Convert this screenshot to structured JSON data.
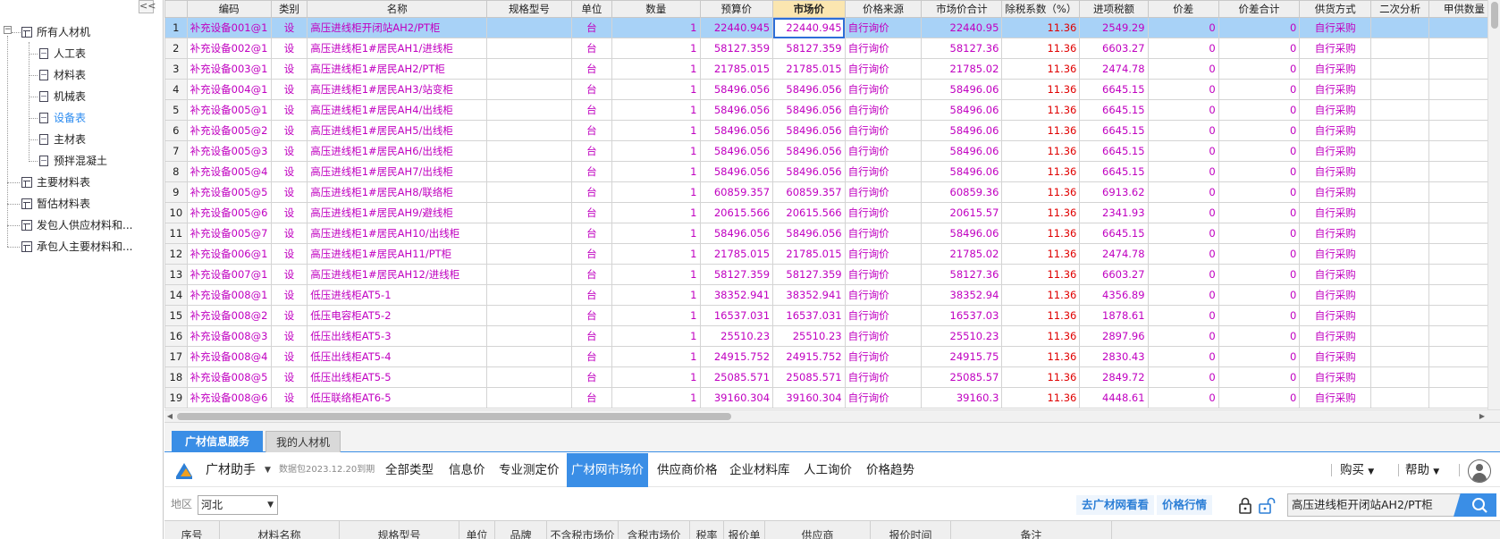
{
  "tree": {
    "collapse_label": "<<",
    "items": [
      {
        "label": "所有人材机",
        "icon": "table-icon"
      },
      {
        "label": "人工表",
        "icon": "doc-icon"
      },
      {
        "label": "材料表",
        "icon": "doc-icon"
      },
      {
        "label": "机械表",
        "icon": "doc-icon"
      },
      {
        "label": "设备表",
        "icon": "doc-icon",
        "selected": true
      },
      {
        "label": "主材表",
        "icon": "doc-icon"
      },
      {
        "label": "预拌混凝土",
        "icon": "doc-icon"
      },
      {
        "label": "主要材料表",
        "icon": "table-icon"
      },
      {
        "label": "暂估材料表",
        "icon": "table-icon"
      },
      {
        "label": "发包人供应材料和...",
        "icon": "table-icon"
      },
      {
        "label": "承包人主要材料和...",
        "icon": "table-icon"
      }
    ]
  },
  "grid": {
    "headers": [
      "编码",
      "类别",
      "名称",
      "规格型号",
      "单位",
      "数量",
      "预算价",
      "市场价",
      "价格来源",
      "市场价合计",
      "除税系数（%）",
      "进项税额",
      "价差",
      "价差合计",
      "供货方式",
      "二次分析",
      "甲供数量"
    ],
    "active_header": "市场价",
    "rows": [
      [
        "1",
        "补充设备001@1",
        "设",
        "高压进线柜开闭站AH2/PT柜",
        "",
        "台",
        "1",
        "22440.945",
        "22440.945",
        "自行询价",
        "22440.95",
        "11.36",
        "2549.29",
        "0",
        "0",
        "自行采购",
        "",
        ""
      ],
      [
        "2",
        "补充设备002@1",
        "设",
        "高压进线柜1#居民AH1/进线柜",
        "",
        "台",
        "1",
        "58127.359",
        "58127.359",
        "自行询价",
        "58127.36",
        "11.36",
        "6603.27",
        "0",
        "0",
        "自行采购",
        "",
        ""
      ],
      [
        "3",
        "补充设备003@1",
        "设",
        "高压进线柜1#居民AH2/PT柜",
        "",
        "台",
        "1",
        "21785.015",
        "21785.015",
        "自行询价",
        "21785.02",
        "11.36",
        "2474.78",
        "0",
        "0",
        "自行采购",
        "",
        ""
      ],
      [
        "4",
        "补充设备004@1",
        "设",
        "高压进线柜1#居民AH3/站变柜",
        "",
        "台",
        "1",
        "58496.056",
        "58496.056",
        "自行询价",
        "58496.06",
        "11.36",
        "6645.15",
        "0",
        "0",
        "自行采购",
        "",
        ""
      ],
      [
        "5",
        "补充设备005@1",
        "设",
        "高压进线柜1#居民AH4/出线柜",
        "",
        "台",
        "1",
        "58496.056",
        "58496.056",
        "自行询价",
        "58496.06",
        "11.36",
        "6645.15",
        "0",
        "0",
        "自行采购",
        "",
        ""
      ],
      [
        "6",
        "补充设备005@2",
        "设",
        "高压进线柜1#居民AH5/出线柜",
        "",
        "台",
        "1",
        "58496.056",
        "58496.056",
        "自行询价",
        "58496.06",
        "11.36",
        "6645.15",
        "0",
        "0",
        "自行采购",
        "",
        ""
      ],
      [
        "7",
        "补充设备005@3",
        "设",
        "高压进线柜1#居民AH6/出线柜",
        "",
        "台",
        "1",
        "58496.056",
        "58496.056",
        "自行询价",
        "58496.06",
        "11.36",
        "6645.15",
        "0",
        "0",
        "自行采购",
        "",
        ""
      ],
      [
        "8",
        "补充设备005@4",
        "设",
        "高压进线柜1#居民AH7/出线柜",
        "",
        "台",
        "1",
        "58496.056",
        "58496.056",
        "自行询价",
        "58496.06",
        "11.36",
        "6645.15",
        "0",
        "0",
        "自行采购",
        "",
        ""
      ],
      [
        "9",
        "补充设备005@5",
        "设",
        "高压进线柜1#居民AH8/联络柜",
        "",
        "台",
        "1",
        "60859.357",
        "60859.357",
        "自行询价",
        "60859.36",
        "11.36",
        "6913.62",
        "0",
        "0",
        "自行采购",
        "",
        ""
      ],
      [
        "10",
        "补充设备005@6",
        "设",
        "高压进线柜1#居民AH9/避线柜",
        "",
        "台",
        "1",
        "20615.566",
        "20615.566",
        "自行询价",
        "20615.57",
        "11.36",
        "2341.93",
        "0",
        "0",
        "自行采购",
        "",
        ""
      ],
      [
        "11",
        "补充设备005@7",
        "设",
        "高压进线柜1#居民AH10/出线柜",
        "",
        "台",
        "1",
        "58496.056",
        "58496.056",
        "自行询价",
        "58496.06",
        "11.36",
        "6645.15",
        "0",
        "0",
        "自行采购",
        "",
        ""
      ],
      [
        "12",
        "补充设备006@1",
        "设",
        "高压进线柜1#居民AH11/PT柜",
        "",
        "台",
        "1",
        "21785.015",
        "21785.015",
        "自行询价",
        "21785.02",
        "11.36",
        "2474.78",
        "0",
        "0",
        "自行采购",
        "",
        ""
      ],
      [
        "13",
        "补充设备007@1",
        "设",
        "高压进线柜1#居民AH12/进线柜",
        "",
        "台",
        "1",
        "58127.359",
        "58127.359",
        "自行询价",
        "58127.36",
        "11.36",
        "6603.27",
        "0",
        "0",
        "自行采购",
        "",
        ""
      ],
      [
        "14",
        "补充设备008@1",
        "设",
        "低压进线柜AT5-1",
        "",
        "台",
        "1",
        "38352.941",
        "38352.941",
        "自行询价",
        "38352.94",
        "11.36",
        "4356.89",
        "0",
        "0",
        "自行采购",
        "",
        ""
      ],
      [
        "15",
        "补充设备008@2",
        "设",
        "低压电容柜AT5-2",
        "",
        "台",
        "1",
        "16537.031",
        "16537.031",
        "自行询价",
        "16537.03",
        "11.36",
        "1878.61",
        "0",
        "0",
        "自行采购",
        "",
        ""
      ],
      [
        "16",
        "补充设备008@3",
        "设",
        "低压出线柜AT5-3",
        "",
        "台",
        "1",
        "25510.23",
        "25510.23",
        "自行询价",
        "25510.23",
        "11.36",
        "2897.96",
        "0",
        "0",
        "自行采购",
        "",
        ""
      ],
      [
        "17",
        "补充设备008@4",
        "设",
        "低压出线柜AT5-4",
        "",
        "台",
        "1",
        "24915.752",
        "24915.752",
        "自行询价",
        "24915.75",
        "11.36",
        "2830.43",
        "0",
        "0",
        "自行采购",
        "",
        ""
      ],
      [
        "18",
        "补充设备008@5",
        "设",
        "低压出线柜AT5-5",
        "",
        "台",
        "1",
        "25085.571",
        "25085.571",
        "自行询价",
        "25085.57",
        "11.36",
        "2849.72",
        "0",
        "0",
        "自行采购",
        "",
        ""
      ],
      [
        "19",
        "补充设备008@6",
        "设",
        "低压联络柜AT6-5",
        "",
        "台",
        "1",
        "39160.304",
        "39160.304",
        "自行询价",
        "39160.3",
        "11.36",
        "4448.61",
        "0",
        "0",
        "自行采购",
        "",
        ""
      ]
    ]
  },
  "panel": {
    "tabs": [
      "广材信息服务",
      "我的人材机"
    ],
    "brand": "广材助手",
    "package_info": "数据包2023.12.20到期",
    "nav": [
      "全部类型",
      "信息价",
      "专业测定价",
      "广材网市场价",
      "供应商价格",
      "企业材料库",
      "人工询价",
      "价格趋势"
    ],
    "active_nav": "广材网市场价",
    "buy": "购买",
    "help": "帮助",
    "region_label": "地区",
    "region_value": "河北",
    "link_site": "去广材网看看",
    "link_market": "价格行情",
    "search_value": "高压进线柜开闭站AH2/PT柜",
    "columns": [
      "序号",
      "材料名称",
      "规格型号",
      "单位",
      "品牌",
      "不含税市场价",
      "含税市场价",
      "税率",
      "报价单",
      "供应商",
      "报价时间",
      "备注"
    ]
  },
  "colors": {
    "accent": "#3a8ee6",
    "magenta_text": "#c000c0",
    "red_text": "#e00000",
    "selected_row": "#a8d2f7",
    "active_header": "#fbe6b0"
  }
}
